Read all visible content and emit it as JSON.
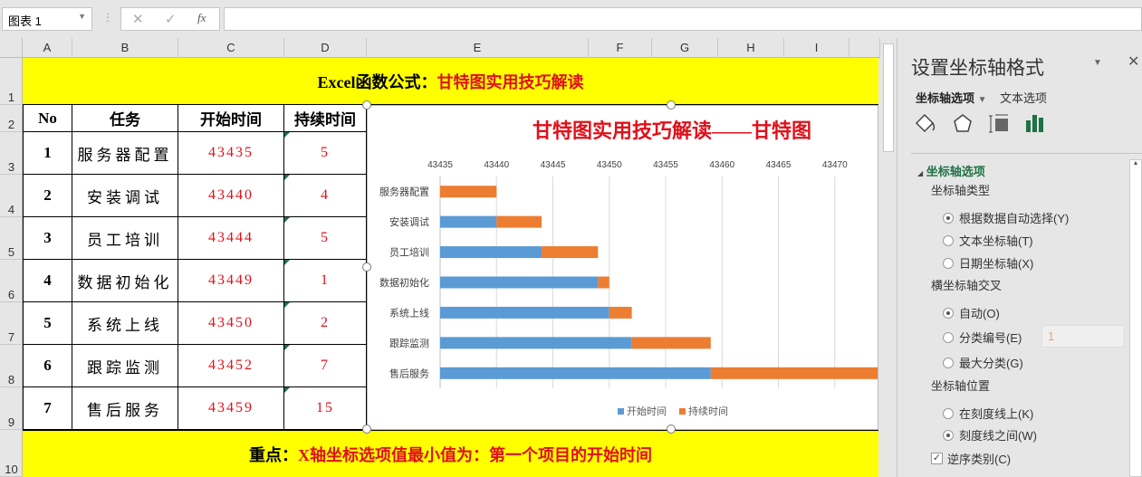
{
  "formula_bar": {
    "name_box": "图表 1",
    "cancel": "✕",
    "enter": "✓",
    "fx": "fx",
    "formula": ""
  },
  "columns": [
    "A",
    "B",
    "C",
    "D",
    "E",
    "F",
    "G",
    "H",
    "I"
  ],
  "rows": [
    "1",
    "2",
    "3",
    "4",
    "5",
    "6",
    "7",
    "8",
    "9",
    "10"
  ],
  "sheet": {
    "title_black": "Excel函数公式：",
    "title_red": "甘特图实用技巧解读",
    "headers": [
      "No",
      "任务",
      "开始时间",
      "持续时间"
    ],
    "data": [
      {
        "no": "1",
        "task": "服务器配置",
        "start": "43435",
        "dur": "5"
      },
      {
        "no": "2",
        "task": "安装调试",
        "start": "43440",
        "dur": "4"
      },
      {
        "no": "3",
        "task": "员工培训",
        "start": "43444",
        "dur": "5"
      },
      {
        "no": "4",
        "task": "数据初始化",
        "start": "43449",
        "dur": "1"
      },
      {
        "no": "5",
        "task": "系统上线",
        "start": "43450",
        "dur": "2"
      },
      {
        "no": "6",
        "task": "跟踪监测",
        "start": "43452",
        "dur": "7"
      },
      {
        "no": "7",
        "task": "售后服务",
        "start": "43459",
        "dur": "15"
      }
    ],
    "note_black": "重点：",
    "note_red": "X轴坐标选项值最小值为：第一个项目的开始时间"
  },
  "chart_data": {
    "type": "bar",
    "stacked": true,
    "orientation": "horizontal",
    "title": "甘特图实用技巧解读——甘特图",
    "categories": [
      "服务器配置",
      "安装调试",
      "员工培训",
      "数据初始化",
      "系统上线",
      "跟踪监测",
      "售后服务"
    ],
    "series": [
      {
        "name": "开始时间",
        "color": "#5b9bd5",
        "values": [
          43435,
          43440,
          43444,
          43449,
          43450,
          43452,
          43459
        ]
      },
      {
        "name": "持续时间",
        "color": "#ed7d31",
        "values": [
          5,
          4,
          5,
          1,
          2,
          7,
          15
        ]
      }
    ],
    "xlim": [
      43435,
      43475
    ],
    "xticks": [
      "43435",
      "43440",
      "43445",
      "43450",
      "43455",
      "43460",
      "43465",
      "43470"
    ],
    "legend": "bottom"
  },
  "panel": {
    "title": "设置坐标轴格式",
    "tab1": "坐标轴选项",
    "tab2": "文本选项",
    "section": "坐标轴选项",
    "group1": "坐标轴类型",
    "g1": [
      "根据数据自动选择(Y)",
      "文本坐标轴(T)",
      "日期坐标轴(X)"
    ],
    "group2": "横坐标轴交叉",
    "g2": [
      "自动(O)",
      "分类编号(E)",
      "最大分类(G)"
    ],
    "cat_value": "1",
    "group3": "坐标轴位置",
    "g3": [
      "在刻度线上(K)",
      "刻度线之间(W)"
    ],
    "reverse": "逆序类别(C)"
  }
}
